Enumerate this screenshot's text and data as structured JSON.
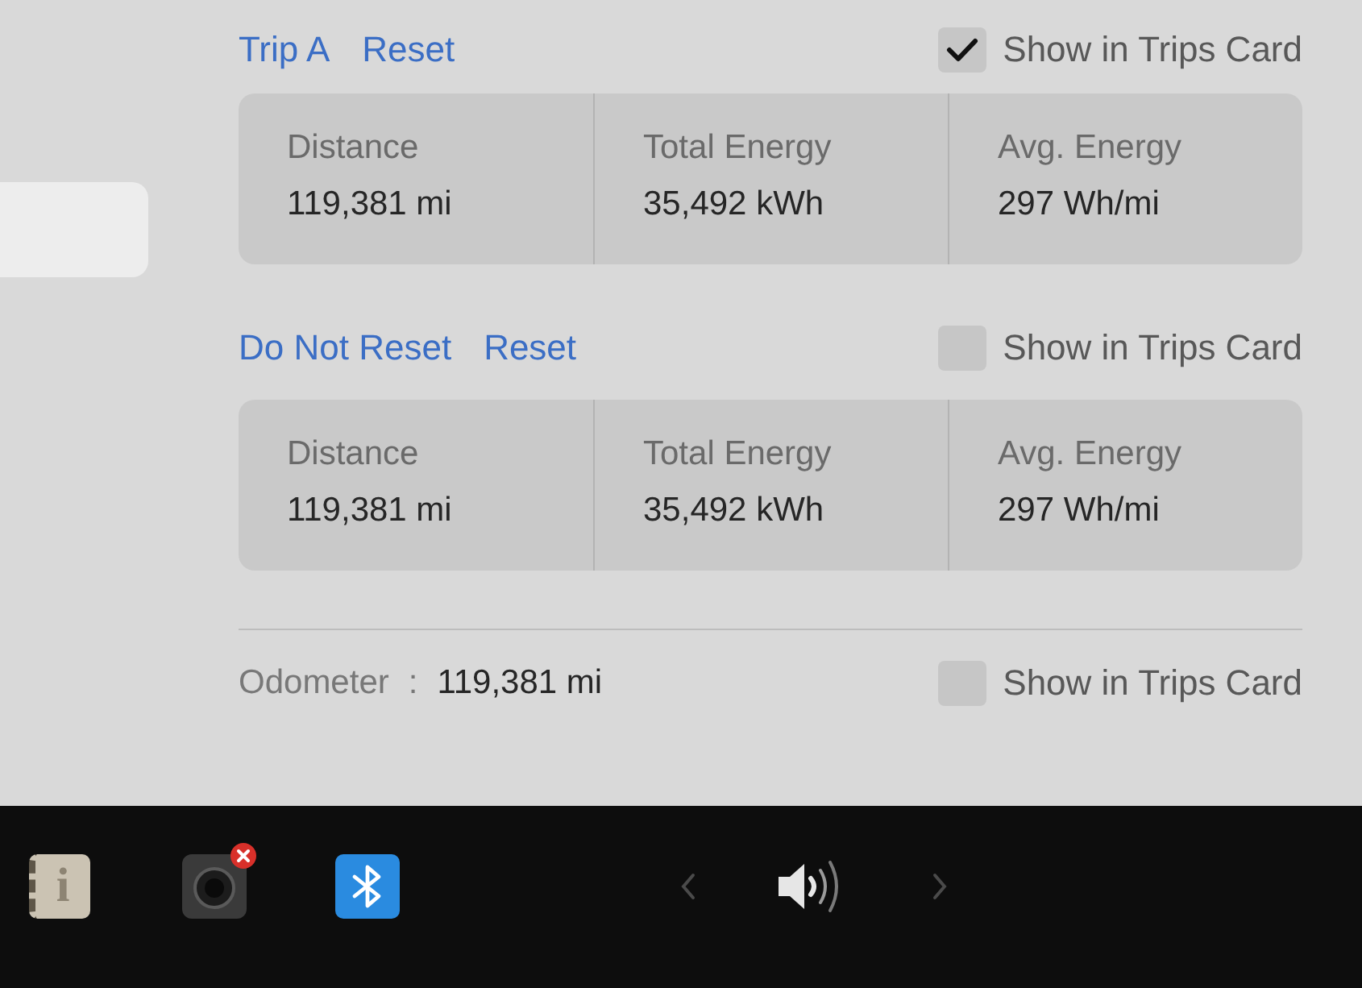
{
  "sidebar": {
    "items": [
      {
        "selected": true
      }
    ]
  },
  "trips": [
    {
      "name": "Trip A",
      "reset_label": "Reset",
      "show_in_trips_card": {
        "label": "Show in Trips Card",
        "checked": true
      },
      "stats": [
        {
          "label": "Distance",
          "value": "119,381 mi"
        },
        {
          "label": "Total Energy",
          "value": "35,492 kWh"
        },
        {
          "label": "Avg. Energy",
          "value": "297 Wh/mi"
        }
      ]
    },
    {
      "name": "Do Not Reset",
      "reset_label": "Reset",
      "show_in_trips_card": {
        "label": "Show in Trips Card",
        "checked": false
      },
      "stats": [
        {
          "label": "Distance",
          "value": "119,381 mi"
        },
        {
          "label": "Total Energy",
          "value": "35,492 kWh"
        },
        {
          "label": "Avg. Energy",
          "value": "297 Wh/mi"
        }
      ]
    }
  ],
  "odometer": {
    "label": "Odometer",
    "separator": ":",
    "value": "119,381 mi",
    "show_in_trips_card": {
      "label": "Show in Trips Card",
      "checked": false
    }
  },
  "taskbar": {
    "apps": [
      {
        "kind": "manual",
        "glyph": "i",
        "alert": false
      },
      {
        "kind": "camera",
        "alert": true
      },
      {
        "kind": "bluetooth",
        "alert": false
      }
    ]
  }
}
